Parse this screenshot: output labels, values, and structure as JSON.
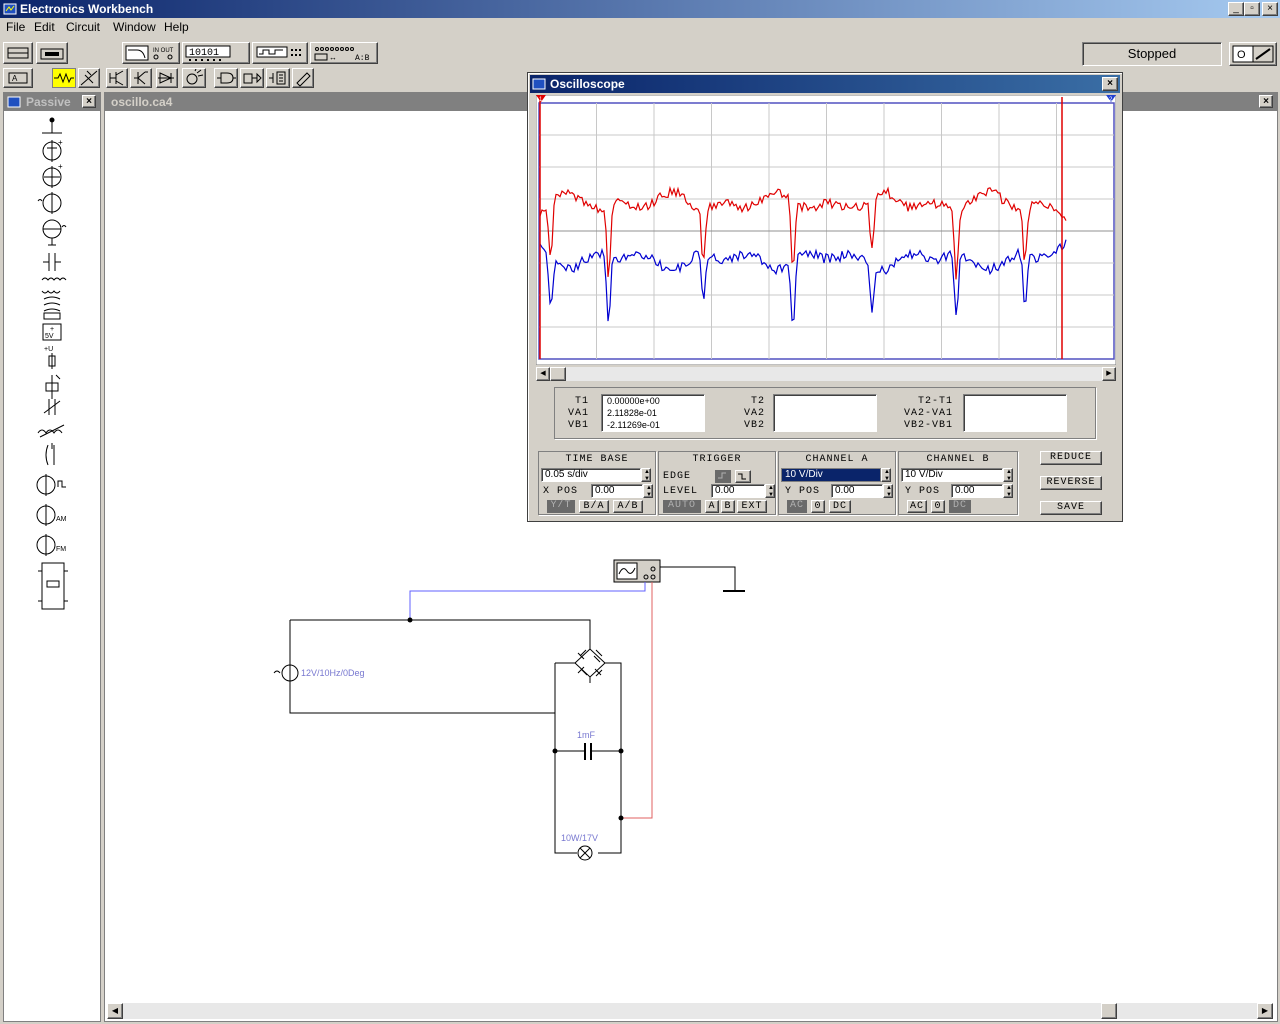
{
  "app": {
    "title": "Electronics Workbench"
  },
  "menu": [
    "File",
    "Edit",
    "Circuit",
    "Window",
    "Help"
  ],
  "window_controls": {
    "minimize": "_",
    "restore": "▫",
    "close": "×"
  },
  "toolbar": {
    "status": "Stopped",
    "counter_label": "10101",
    "inout_label": "IN  OUT",
    "ab_label": "A:B"
  },
  "parts_bin": {
    "title": "Passive",
    "close": "×"
  },
  "circuit_window": {
    "title": "oscillo.ca4",
    "close": "×"
  },
  "circuit": {
    "source_label": "12V/10Hz/0Deg",
    "capacitor_label": "1mF",
    "lamp_label": "10W/17V"
  },
  "oscilloscope": {
    "title": "Oscilloscope",
    "close": "×",
    "readout": {
      "t1_labels": [
        "T1",
        "VA1",
        "VB1"
      ],
      "t1_values": [
        "0.00000e+00",
        "2.11828e-01",
        "-2.11269e-01"
      ],
      "t2_labels": [
        "T2",
        "VA2",
        "VB2"
      ],
      "diff_labels": [
        "T2-T1",
        "VA2-VA1",
        "VB2-VB1"
      ]
    },
    "time_base": {
      "title": "TIME BASE",
      "value": "0.05 s/div",
      "xpos_label": "X POS",
      "xpos": "0.00",
      "buttons": [
        "Y/T",
        "B/A",
        "A/B"
      ]
    },
    "trigger": {
      "title": "TRIGGER",
      "edge_label": "EDGE",
      "level_label": "LEVEL",
      "level": "0.00",
      "buttons": [
        "AUTO",
        "A",
        "B",
        "EXT"
      ]
    },
    "channel_a": {
      "title": "CHANNEL A",
      "value": "10 V/Div",
      "ypos_label": "Y POS",
      "ypos": "0.00",
      "buttons": [
        "AC",
        "0",
        "DC"
      ]
    },
    "channel_b": {
      "title": "CHANNEL B",
      "value": "10 V/Div",
      "ypos_label": "Y POS",
      "ypos": "0.00",
      "buttons": [
        "AC",
        "0",
        "DC"
      ]
    },
    "side_buttons": [
      "REDUCE",
      "REVERSE",
      "SAVE"
    ],
    "cursor_labels": [
      "1",
      "2"
    ],
    "colors": {
      "channel_a": "#e00000",
      "channel_b": "#0000d0",
      "grid": "#c8c8c8",
      "cursor": "#e00000"
    }
  }
}
